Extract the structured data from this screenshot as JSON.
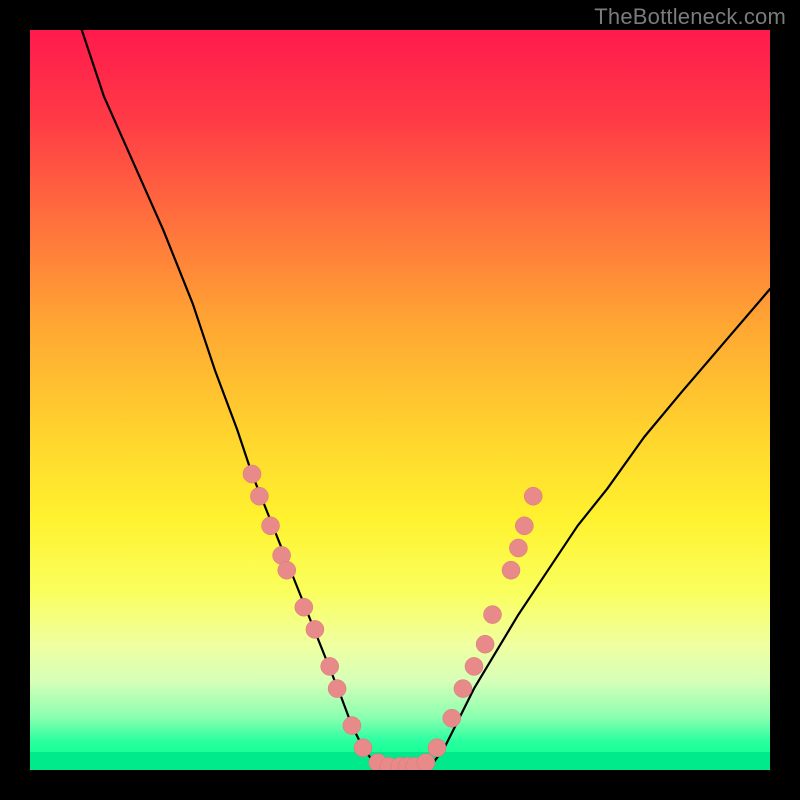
{
  "watermark": "TheBottleneck.com",
  "colors": {
    "dot_fill": "#e88a8a",
    "dot_stroke": "#d87777",
    "curve": "#000000",
    "background_black": "#000000",
    "gradient_top": "#ff1a4d",
    "gradient_bottom": "#00ff8a"
  },
  "chart_data": {
    "type": "line",
    "title": "",
    "xlabel": "",
    "ylabel": "",
    "xlim": [
      0,
      100
    ],
    "ylim": [
      0,
      100
    ],
    "grid": false,
    "legend": false,
    "curve_left": {
      "x": [
        7,
        10,
        14,
        18,
        22,
        25,
        28,
        30,
        32,
        34,
        36,
        38,
        40,
        42,
        43.5,
        45,
        46.5,
        48
      ],
      "y": [
        100,
        91,
        82,
        73,
        63,
        54,
        46,
        40,
        35,
        30,
        25,
        20,
        15,
        10,
        6,
        3,
        1,
        0
      ]
    },
    "curve_flat": {
      "x": [
        48,
        49,
        50,
        51,
        52,
        53
      ],
      "y": [
        0,
        0,
        0,
        0,
        0,
        0
      ]
    },
    "curve_right": {
      "x": [
        53,
        54.5,
        56,
        58,
        60,
        63,
        66,
        70,
        74,
        78,
        83,
        88,
        94,
        100
      ],
      "y": [
        0,
        1,
        3,
        7,
        11,
        16,
        21,
        27,
        33,
        38,
        45,
        51,
        58,
        65
      ]
    },
    "series": [
      {
        "name": "dots-left",
        "points": [
          {
            "x": 30.0,
            "y": 40
          },
          {
            "x": 31.0,
            "y": 37
          },
          {
            "x": 32.5,
            "y": 33
          },
          {
            "x": 34.0,
            "y": 29
          },
          {
            "x": 34.7,
            "y": 27
          },
          {
            "x": 37.0,
            "y": 22
          },
          {
            "x": 38.5,
            "y": 19
          },
          {
            "x": 40.5,
            "y": 14
          },
          {
            "x": 41.5,
            "y": 11
          },
          {
            "x": 43.5,
            "y": 6
          },
          {
            "x": 45.0,
            "y": 3
          }
        ]
      },
      {
        "name": "dots-flat",
        "points": [
          {
            "x": 47.0,
            "y": 1
          },
          {
            "x": 48.5,
            "y": 0.5
          },
          {
            "x": 50.0,
            "y": 0.5
          },
          {
            "x": 51.0,
            "y": 0.5
          },
          {
            "x": 52.0,
            "y": 0.5
          },
          {
            "x": 53.5,
            "y": 1
          }
        ]
      },
      {
        "name": "dots-right",
        "points": [
          {
            "x": 55.0,
            "y": 3
          },
          {
            "x": 57.0,
            "y": 7
          },
          {
            "x": 58.5,
            "y": 11
          },
          {
            "x": 60.0,
            "y": 14
          },
          {
            "x": 61.5,
            "y": 17
          },
          {
            "x": 62.5,
            "y": 21
          },
          {
            "x": 65.0,
            "y": 27
          },
          {
            "x": 66.0,
            "y": 30
          },
          {
            "x": 66.8,
            "y": 33
          },
          {
            "x": 68.0,
            "y": 37
          }
        ]
      }
    ]
  }
}
